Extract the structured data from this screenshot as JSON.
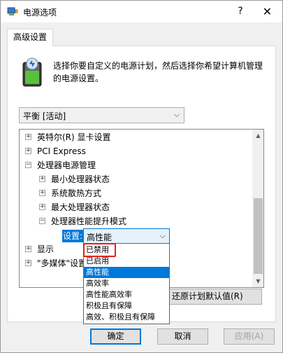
{
  "window": {
    "title": "电源选项",
    "help": "?",
    "close": "✕"
  },
  "tab": {
    "label": "高级设置"
  },
  "description": "选择你要自定义的电源计划，然后选择你希望计算机管理的电源设置。",
  "plan_select": {
    "value": "平衡 [活动]"
  },
  "tree": [
    {
      "sign": "+",
      "label": "英特尔(R) 显卡设置"
    },
    {
      "sign": "+",
      "label": "PCI Express"
    },
    {
      "sign": "−",
      "label": "处理器电源管理"
    },
    {
      "sign": "+",
      "label": "最小处理器状态"
    },
    {
      "sign": "+",
      "label": "系统散热方式"
    },
    {
      "sign": "+",
      "label": "最大处理器状态"
    },
    {
      "sign": "−",
      "label": "处理器性能提升模式"
    },
    {
      "sign": "+",
      "label": "显示"
    },
    {
      "sign": "+",
      "label": "\"多媒体\"设置"
    }
  ],
  "setting_label": "设置:",
  "setting_select": {
    "value": "高性能"
  },
  "dropdown_options": [
    "已禁用",
    "已启用",
    "高性能",
    "高效率",
    "高性能高效率",
    "积极且有保障",
    "高效、积极且有保障"
  ],
  "selected_option": "高性能",
  "restore_button": "还原计划默认值(R)",
  "buttons": {
    "ok": "确定",
    "cancel": "取消",
    "apply": "应用(A)"
  },
  "icons": [
    "power-options-icon",
    "battery-plan-icon",
    "help-icon",
    "close-icon",
    "chevron-down-icon",
    "expand-icon",
    "collapse-icon",
    "scroll-up-icon",
    "scroll-down-icon"
  ],
  "colors": {
    "accent": "#0078d7",
    "highlight_box": "#e02020"
  }
}
